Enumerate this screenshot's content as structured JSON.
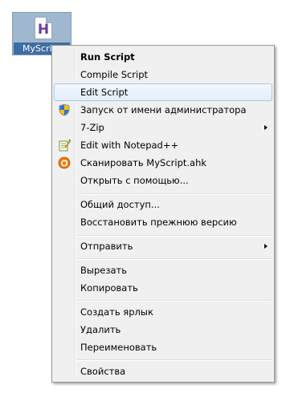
{
  "desktop_file": {
    "name": "MyScript",
    "icon_letter": "H"
  },
  "context_menu": {
    "run_script": "Run Script",
    "compile_script": "Compile Script",
    "edit_script": "Edit Script",
    "run_as_admin": "Запуск от имени администратора",
    "seven_zip": "7-Zip",
    "edit_notepadpp": "Edit with Notepad++",
    "scan": "Сканировать MyScript.ahk",
    "open_with": "Открыть с помощью...",
    "sharing": "Общий доступ...",
    "restore_previous": "Восстановить прежнюю версию",
    "send_to": "Отправить",
    "cut": "Вырезать",
    "copy": "Копировать",
    "create_shortcut": "Создать ярлык",
    "delete": "Удалить",
    "rename": "Переименовать",
    "properties": "Свойства"
  }
}
